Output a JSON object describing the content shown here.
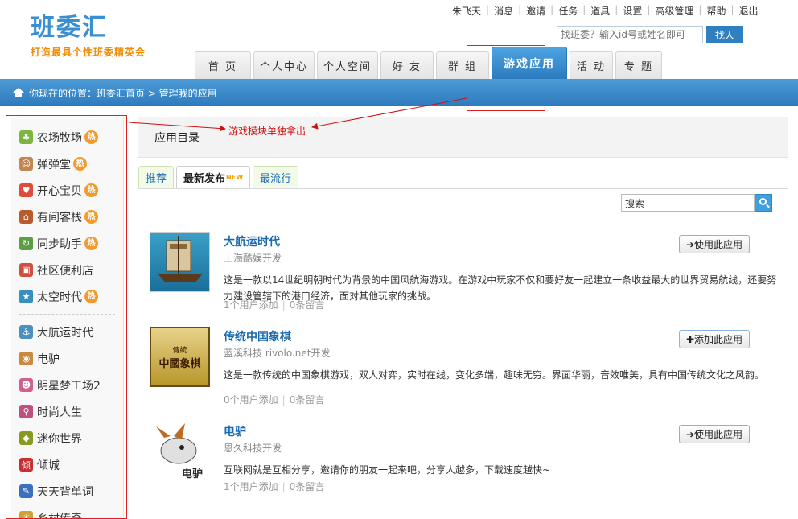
{
  "logo": {
    "title": "班委汇",
    "slogan": "打造最具个性班委精英会"
  },
  "topnav": [
    "朱飞天",
    "消息",
    "邀请",
    "任务",
    "道具",
    "设置",
    "高级管理",
    "帮助",
    "退出"
  ],
  "search_top": {
    "placeholder": "找班委？输入id号或姓名即可",
    "button": "找人"
  },
  "mainnav": [
    {
      "label": "首 页"
    },
    {
      "label": "个人中心"
    },
    {
      "label": "个人空间"
    },
    {
      "label": "好 友"
    },
    {
      "label": "群 组"
    },
    {
      "label": "游戏应用",
      "active": true
    },
    {
      "label": "活 动"
    },
    {
      "label": "专 题"
    }
  ],
  "breadcrumb": {
    "text": "你现在的位置：班委汇首页 > 管理我的应用"
  },
  "annotation": {
    "text": "游戏模块单独拿出"
  },
  "sidebar": {
    "hot_label": "热",
    "items": [
      {
        "label": "农场牧场",
        "hot": true,
        "color": "#7bb642",
        "glyph": "♣"
      },
      {
        "label": "弹弹堂",
        "hot": true,
        "color": "#c08850",
        "glyph": "☺"
      },
      {
        "label": "开心宝贝",
        "hot": true,
        "color": "#e04c3c",
        "glyph": "♥"
      },
      {
        "label": "有间客栈",
        "hot": true,
        "color": "#b85c30",
        "glyph": "⌂"
      },
      {
        "label": "同步助手",
        "hot": true,
        "color": "#5aa040",
        "glyph": "↻"
      },
      {
        "label": "社区便利店",
        "hot": false,
        "color": "#d05040",
        "glyph": "▣"
      },
      {
        "label": "太空时代",
        "hot": true,
        "color": "#3a8fbf",
        "glyph": "★"
      },
      {
        "label": "大航运时代",
        "hot": false,
        "color": "#4a90c0",
        "glyph": "⚓"
      },
      {
        "label": "电驴",
        "hot": false,
        "color": "#c88a40",
        "glyph": "◉"
      },
      {
        "label": "明星梦工场2",
        "hot": false,
        "color": "#d06090",
        "glyph": "☻"
      },
      {
        "label": "时尚人生",
        "hot": false,
        "color": "#c05080",
        "glyph": "♀"
      },
      {
        "label": "迷你世界",
        "hot": false,
        "color": "#8a9a20",
        "glyph": "◆"
      },
      {
        "label": "倾城",
        "hot": false,
        "color": "#c83030",
        "glyph": "倾"
      },
      {
        "label": "天天背单词",
        "hot": false,
        "color": "#3a70c0",
        "glyph": "✎"
      },
      {
        "label": "乡村传奇",
        "hot": false,
        "color": "#d0a030",
        "glyph": "☀"
      }
    ]
  },
  "main": {
    "heading": "应用目录",
    "tabs": [
      {
        "label": "推荐"
      },
      {
        "label": "最新发布",
        "active": true,
        "badge": "NEW"
      },
      {
        "label": "最流行"
      }
    ],
    "search": {
      "value": "搜索"
    },
    "apps": [
      {
        "name": "大航运时代",
        "developer": "上海酷娱开发",
        "description": "这是一款以14世纪明朝时代为背景的中国风航海游戏。在游戏中玩家不仅和要好友一起建立一条收益最大的世界贸易航线，还要努力建设管辖下的港口经济，面对其他玩家的挑战。",
        "users": "1个用户添加",
        "comments": "0条留言",
        "button": "➔使用此应用",
        "thumb": "ship"
      },
      {
        "name": "传统中国象棋",
        "developer": "蓝溪科技 rivolo.net开发",
        "description": "这是一款传统的中国象棋游戏，双人对弈，实时在线，变化多端，趣味无穷。界面华丽，音效唯美，具有中国传统文化之风韵。",
        "users": "0个用户添加",
        "comments": "0条留言",
        "button": "✚添加此应用",
        "thumb": "chess",
        "thumb_text_small": "傳統",
        "thumb_text_big": "中國象棋"
      },
      {
        "name": "电驴",
        "developer": "恩久科技开发",
        "description": "互联网就是互相分享，邀请你的朋友一起来吧，分享人越多，下载速度越快~",
        "users": "1个用户添加",
        "comments": "0条留言",
        "button": "➔使用此应用",
        "thumb": "donkey",
        "thumb_text": "电驴"
      }
    ]
  }
}
